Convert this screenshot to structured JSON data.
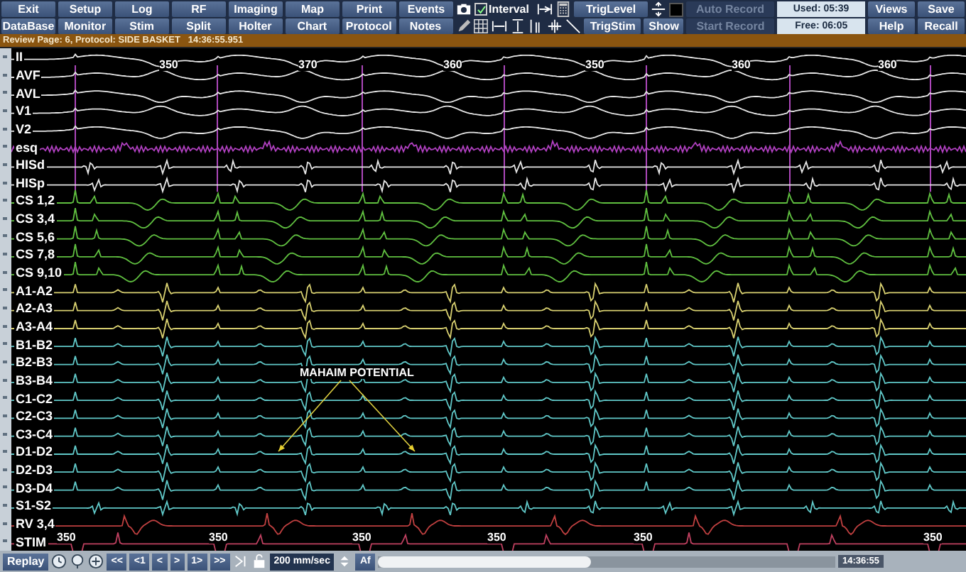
{
  "toolbar": {
    "row1_buttons": [
      "Exit",
      "Setup",
      "Log",
      "RF",
      "Imaging",
      "Map",
      "Print",
      "Events"
    ],
    "row2_buttons": [
      "DataBase",
      "Monitor",
      "Stim",
      "Split",
      "Holter",
      "Chart",
      "Protocol",
      "Notes"
    ],
    "interval": {
      "label": "Interval",
      "checked": true
    },
    "trig_level": "TrigLevel",
    "trig_stim": "TrigStim",
    "show": "Show",
    "auto_record": {
      "label": "Auto Record",
      "disabled": true
    },
    "start_record": {
      "label": "Start Record",
      "disabled": true
    },
    "used": "Used: 05:39",
    "free": "Free: 06:05",
    "views": "Views",
    "help": "Help",
    "save": "Save",
    "recall": "Recall"
  },
  "status": "Review Page: 6, Protocol: SIDE BASKET   14:36:55.951",
  "channels": [
    {
      "label": "II",
      "kind": "surface",
      "color": "#e6e6e6"
    },
    {
      "label": "AVF",
      "kind": "surface",
      "color": "#e6e6e6"
    },
    {
      "label": "AVL",
      "kind": "surface",
      "color": "#e6e6e6"
    },
    {
      "label": "V1",
      "kind": "surface",
      "color": "#e6e6e6"
    },
    {
      "label": "V2",
      "kind": "surface",
      "color": "#e6e6e6"
    },
    {
      "label": "esq",
      "kind": "esophageal",
      "color": "#b040c0"
    },
    {
      "label": "HISd",
      "kind": "his",
      "color": "#e6e6e6"
    },
    {
      "label": "HISp",
      "kind": "his",
      "color": "#e6e6e6"
    },
    {
      "label": "CS 1,2",
      "kind": "cs",
      "color": "#60c040"
    },
    {
      "label": "CS 3,4",
      "kind": "cs",
      "color": "#60c040"
    },
    {
      "label": "CS 5,6",
      "kind": "cs",
      "color": "#60c040"
    },
    {
      "label": "CS 7,8",
      "kind": "cs",
      "color": "#60c040"
    },
    {
      "label": "CS 9,10",
      "kind": "cs",
      "color": "#60c040"
    },
    {
      "label": "A1-A2",
      "kind": "bipolar",
      "color": "#d8d070"
    },
    {
      "label": "A2-A3",
      "kind": "bipolar",
      "color": "#d8d070"
    },
    {
      "label": "A3-A4",
      "kind": "bipolar",
      "color": "#d8d070"
    },
    {
      "label": "B1-B2",
      "kind": "bipolar",
      "color": "#60c8c8"
    },
    {
      "label": "B2-B3",
      "kind": "bipolar",
      "color": "#60c8c8"
    },
    {
      "label": "B3-B4",
      "kind": "bipolar",
      "color": "#60c8c8"
    },
    {
      "label": "C1-C2",
      "kind": "bipolar",
      "color": "#60c8c8"
    },
    {
      "label": "C2-C3",
      "kind": "bipolar",
      "color": "#60c8c8"
    },
    {
      "label": "C3-C4",
      "kind": "bipolar",
      "color": "#60c8c8"
    },
    {
      "label": "D1-D2",
      "kind": "bipolar",
      "color": "#60c8c8"
    },
    {
      "label": "D2-D3",
      "kind": "bipolar",
      "color": "#60c8c8"
    },
    {
      "label": "D3-D4",
      "kind": "bipolar",
      "color": "#60c8c8"
    },
    {
      "label": "S1-S2",
      "kind": "his",
      "color": "#60c8c8"
    },
    {
      "label": "RV 3,4",
      "kind": "rv",
      "color": "#c04040"
    },
    {
      "label": "STIM",
      "kind": "stim",
      "color": "#c04060"
    }
  ],
  "top_intervals": [
    "350",
    "370",
    "360",
    "350",
    "360",
    "360"
  ],
  "bottom_intervals": [
    "350",
    "350",
    "350",
    "350",
    "350",
    "350"
  ],
  "annotation": "MAHAIM POTENTIAL",
  "bottom_bar": {
    "replay": "Replay",
    "nav": [
      "<<",
      "<1",
      "<",
      ">",
      "1>",
      ">>"
    ],
    "speed": "200 mm/sec",
    "font_button": "Af",
    "time": "14:36:55"
  }
}
